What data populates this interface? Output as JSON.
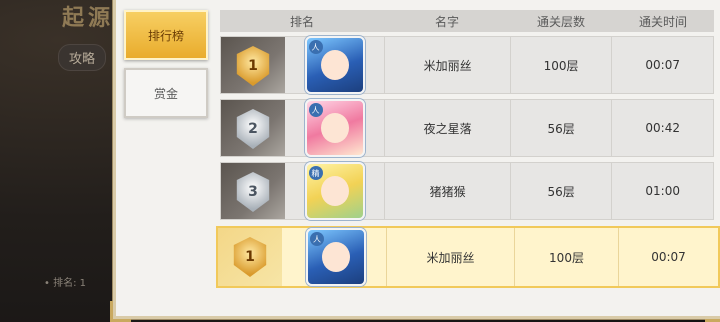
{
  "background": {
    "title": "起源",
    "pill_label": "攻略",
    "rank_text": "• 排名: 1"
  },
  "tabs": [
    {
      "label": "排行榜",
      "active": true
    },
    {
      "label": "赏金",
      "active": false
    }
  ],
  "table": {
    "headers": [
      "排名",
      "名字",
      "通关层数",
      "通关时间"
    ],
    "rows": [
      {
        "rank": "1",
        "medal": "gold",
        "avatar": "blue-haired-girl-avatar",
        "badge": "人",
        "name": "米加丽丝",
        "floor": "100层",
        "time": "00:07"
      },
      {
        "rank": "2",
        "medal": "silver",
        "avatar": "pink-haired-girl-avatar",
        "badge": "人",
        "name": "夜之星落",
        "floor": "56层",
        "time": "00:42"
      },
      {
        "rank": "3",
        "medal": "silver",
        "avatar": "blonde-girl-avatar",
        "badge": "精",
        "name": "猪猪猴",
        "floor": "56层",
        "time": "01:00"
      }
    ],
    "self_row": {
      "rank": "1",
      "medal": "gold",
      "avatar": "blue-haired-girl-avatar",
      "badge": "人",
      "name": "米加丽丝",
      "floor": "100层",
      "time": "00:07"
    }
  },
  "colors": {
    "tab_active": "#e9ac2c",
    "self_row_bg": "#fff4cc",
    "gold_medal": "#d99a2b",
    "silver_medal": "#a8b0b8"
  }
}
